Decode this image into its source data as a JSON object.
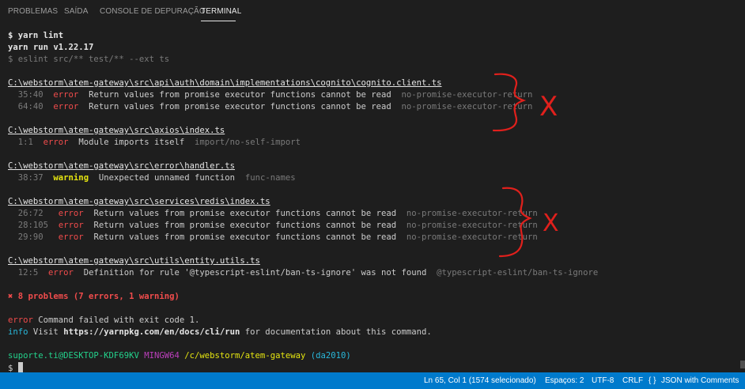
{
  "panel": {
    "tabs": [
      {
        "label": "PROBLEMAS"
      },
      {
        "label": "SAÍDA"
      },
      {
        "label": "CONSOLE DE DEPURAÇÃO"
      },
      {
        "label": "TERMINAL"
      }
    ],
    "active_tab": "TERMINAL"
  },
  "terminal": {
    "cmd_prompt": "$ yarn lint",
    "yarn_version": "yarn run v1.22.17",
    "eslint_cmd": "$ eslint src/** test/** --ext ts",
    "files": [
      {
        "path": "C:\\webstorm\\atem-gateway\\src\\api\\auth\\domain\\implementations\\cognito\\cognito.client.ts",
        "issues": [
          {
            "pos": "35:40",
            "severity": "error",
            "message": "Return values from promise executor functions cannot be read",
            "rule": "no-promise-executor-return"
          },
          {
            "pos": "64:40",
            "severity": "error",
            "message": "Return values from promise executor functions cannot be read",
            "rule": "no-promise-executor-return"
          }
        ]
      },
      {
        "path": "C:\\webstorm\\atem-gateway\\src\\axios\\index.ts",
        "issues": [
          {
            "pos": "1:1",
            "severity": "error",
            "message": "Module imports itself",
            "rule": "import/no-self-import"
          }
        ]
      },
      {
        "path": "C:\\webstorm\\atem-gateway\\src\\error\\handler.ts",
        "issues": [
          {
            "pos": "38:37",
            "severity": "warning",
            "message": "Unexpected unnamed function",
            "rule": "func-names"
          }
        ]
      },
      {
        "path": "C:\\webstorm\\atem-gateway\\src\\services\\redis\\index.ts",
        "issues": [
          {
            "pos": "26:72",
            "severity": "error",
            "message": "Return values from promise executor functions cannot be read",
            "rule": "no-promise-executor-return"
          },
          {
            "pos": "28:105",
            "severity": "error",
            "message": "Return values from promise executor functions cannot be read",
            "rule": "no-promise-executor-return"
          },
          {
            "pos": "29:90",
            "severity": "error",
            "message": "Return values from promise executor functions cannot be read",
            "rule": "no-promise-executor-return"
          }
        ]
      },
      {
        "path": "C:\\webstorm\\atem-gateway\\src\\utils\\entity.utils.ts",
        "issues": [
          {
            "pos": "12:5",
            "severity": "error",
            "message": "Definition for rule '@typescript-eslint/ban-ts-ignore' was not found",
            "rule": "@typescript-eslint/ban-ts-ignore"
          }
        ]
      }
    ],
    "summary": "✖ 8 problems (7 errors, 1 warning)",
    "error_label": "error",
    "error_text": "Command failed with exit code 1.",
    "info_label": "info",
    "info_visit": "Visit ",
    "info_url": "https://yarnpkg.com/en/docs/cli/run",
    "info_tail": " for documentation about this command.",
    "prompt": {
      "user_host": "suporte.ti@DESKTOP-KDF69KV",
      "shell": "MINGW64",
      "cwd": "/c/webstorm/atem-gateway",
      "branch": "(da2010)"
    },
    "final_prompt": "$"
  },
  "annotations": {
    "mark1": "X",
    "mark2": "X"
  },
  "statusbar": {
    "position": "Ln 65, Col 1 (1574 selecionado)",
    "indent": "Espaços: 2",
    "encoding": "UTF-8",
    "eol": "CRLF",
    "language": "JSON with Comments"
  },
  "colors": {
    "background": "#1e1e1e",
    "error": "#f14c4c",
    "warning": "#e5e510",
    "statusbar": "#007acc",
    "annotation": "#e0201c"
  }
}
